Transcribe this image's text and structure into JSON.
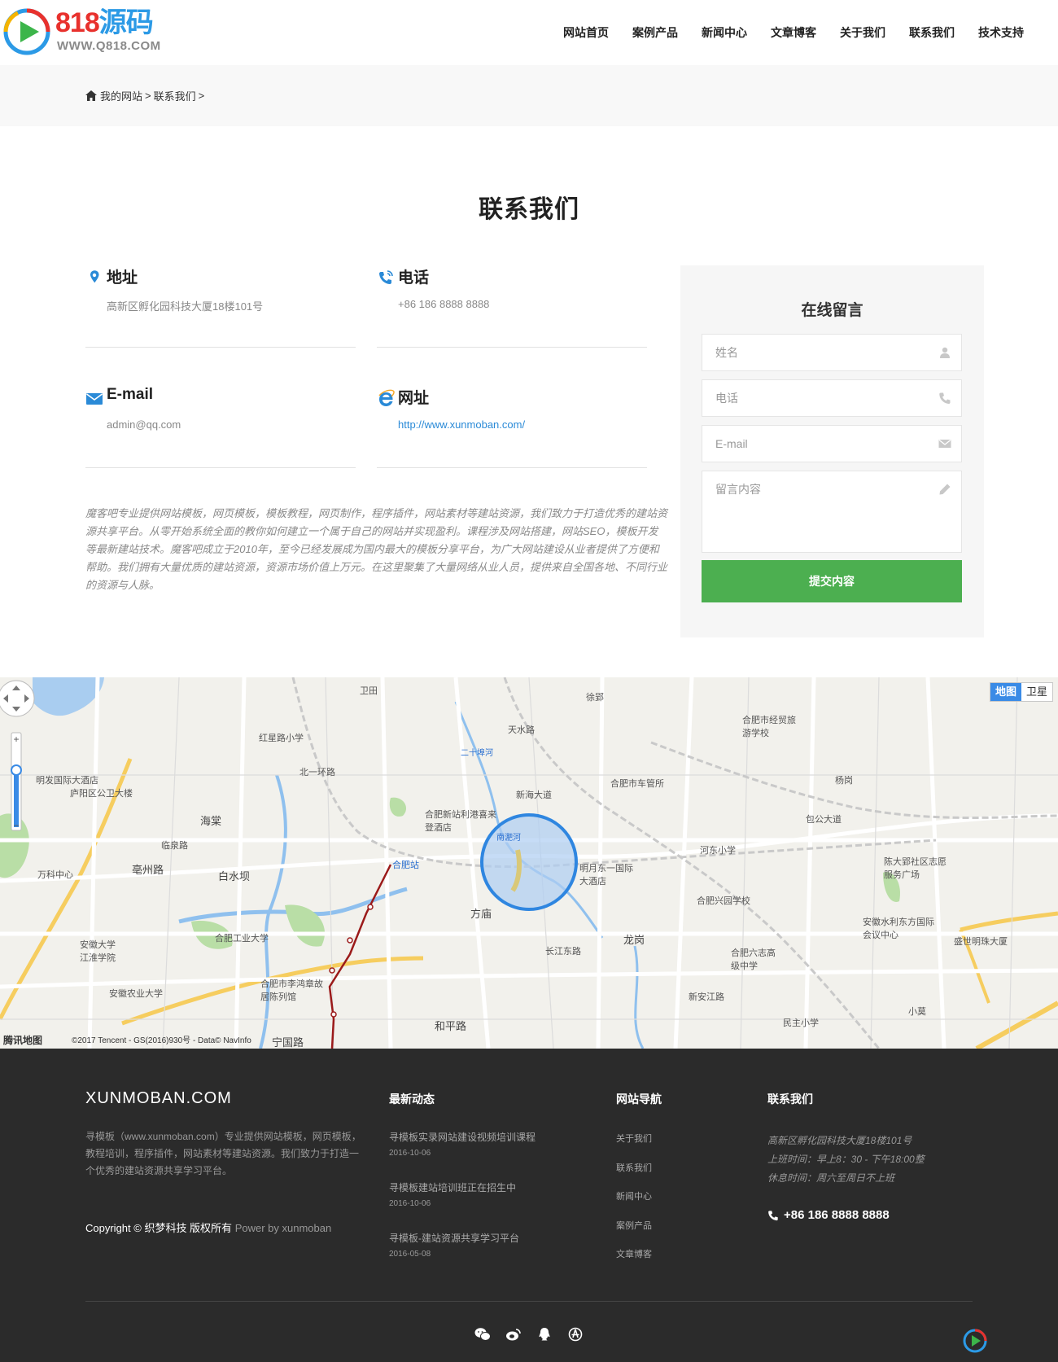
{
  "brand": {
    "logo_number": "818",
    "logo_word": "源码",
    "logo_url": "WWW.Q818.COM"
  },
  "nav": [
    "网站首页",
    "案例产品",
    "新闻中心",
    "文章博客",
    "关于我们",
    "联系我们",
    "技术支持"
  ],
  "breadcrumb": {
    "home": "我的网站",
    "current": "联系我们",
    "sep": ">"
  },
  "page_title": "联系我们",
  "contact": {
    "address_label": "地址",
    "address": "高新区孵化园科技大厦18楼101号",
    "phone_label": "电话",
    "phone": "+86 186 8888 8888",
    "email_label": "E-mail",
    "email": "admin@qq.com",
    "site_label": "网址",
    "site": "http://www.xunmoban.com/"
  },
  "intro": "魔客吧专业提供网站模板，网页模板，模板教程，网页制作，程序插件，网站素材等建站资源，我们致力于打造优秀的建站资源共享平台。从零开始系统全面的教你如何建立一个属于自己的网站并实现盈利。课程涉及网站搭建，网站SEO，模板开发等最新建站技术。魔客吧成立于2010年，至今已经发展成为国内最大的模板分享平台，为广大网站建设从业者提供了方便和帮助。我们拥有大量优质的建站资源，资源市场价值上万元。在这里聚集了大量网络从业人员，提供来自全国各地、不同行业的资源与人脉。",
  "form": {
    "title": "在线留言",
    "name_placeholder": "姓名",
    "phone_placeholder": "电话",
    "email_placeholder": "E-mail",
    "message_placeholder": "留言内容",
    "submit": "提交内容"
  },
  "map": {
    "type_map": "地图",
    "type_satellite": "卫星",
    "brand": "腾讯地图",
    "copyright": "©2017 Tencent - GS(2016)930号 - Data© NavInfo",
    "labels": [
      "明发国际大酒店",
      "庐阳区公卫大楼",
      "红星路小学",
      "海棠",
      "亳州路",
      "白水坝",
      "万科中心",
      "合肥新站利港喜来登酒店",
      "合肥站",
      "方庙",
      "明月东一国际大酒店",
      "合肥市车管所",
      "合肥市经贸旅游学校",
      "河东小学",
      "合肥兴园学校",
      "龙岗",
      "合肥工业大学",
      "安徽大学江淮学院",
      "安徽农业大学",
      "合肥市李鸿章故居陈列馆",
      "和平路",
      "宁国路",
      "合肥六志高级中学",
      "安徽水利东方国际会议中心",
      "陈大郢社区志愿服务广场",
      "盛世明珠大厦",
      "民主小学",
      "杨岗",
      "徐郢",
      "卫田",
      "新海大道",
      "包公大道",
      "长江东路",
      "新安江路",
      "二十埠河",
      "北一环路",
      "临泉路",
      "天水路",
      "南淝河",
      "小莫"
    ]
  },
  "footer": {
    "brand": "XUNMOBAN.COM",
    "desc": "寻模板（www.xunmoban.com）专业提供网站模板，网页模板，教程培训，程序插件，网站素材等建站资源。我们致力于打造一个优秀的建站资源共享学习平台。",
    "copyright": "Copyright © 织梦科技 版权所有",
    "power": "Power by xunmoban",
    "news_title": "最新动态",
    "news": [
      {
        "title": "寻模板实录网站建设视频培训课程",
        "date": "2016-10-06"
      },
      {
        "title": "寻模板建站培训班正在招生中",
        "date": "2016-10-06"
      },
      {
        "title": "寻模板-建站资源共享学习平台",
        "date": "2016-05-08"
      }
    ],
    "nav_title": "网站导航",
    "nav": [
      "关于我们",
      "联系我们",
      "新闻中心",
      "案例产品",
      "文章博客"
    ],
    "contact_title": "联系我们",
    "contact_lines": [
      "高新区孵化园科技大厦18楼101号",
      "上班时间：早上8：30 - 下午18:00整",
      "休息时间：周六至周日不上班"
    ],
    "phone": "+86 186 8888 8888"
  },
  "colors": {
    "accent": "#2a8ad7",
    "submit": "#4caf50",
    "footer_bg": "#2b2b2b",
    "logo_red": "#e8312d",
    "logo_blue": "#2c9ae6"
  },
  "icons": [
    "home-icon",
    "map-pin-icon",
    "phone-icon",
    "mail-icon",
    "ie-icon",
    "user-icon",
    "envelope-icon",
    "pencil-icon",
    "wechat-icon",
    "weibo-icon",
    "qq-icon",
    "tencent-icon"
  ]
}
